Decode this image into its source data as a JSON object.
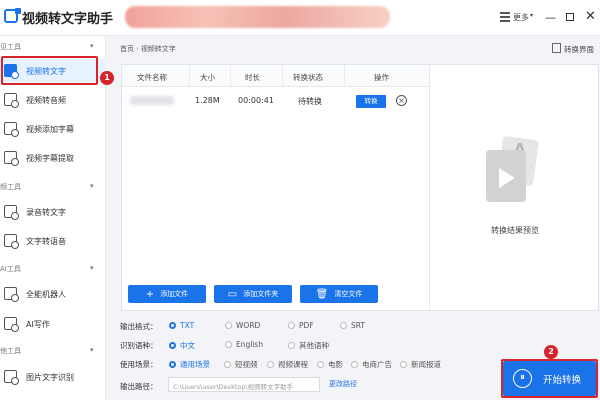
{
  "app": {
    "title": "视频转文字助手"
  },
  "titlebar": {
    "more_label": "更多",
    "more_arrow": "▾",
    "min": "—",
    "max": "",
    "close": "✕"
  },
  "sidebar": {
    "groups": [
      {
        "label": "见工具",
        "caret": "▾"
      },
      {
        "label": "频工具",
        "caret": "▾"
      },
      {
        "label": "AI工具",
        "caret": "▾"
      },
      {
        "label": "他工具",
        "caret": "▾"
      }
    ],
    "items": [
      {
        "label": "视频转文字",
        "active": true
      },
      {
        "label": "视频转音频"
      },
      {
        "label": "视频添加字幕"
      },
      {
        "label": "视频字幕提取"
      },
      {
        "label": "录音转文字"
      },
      {
        "label": "文字转语音"
      },
      {
        "label": "全能机器人"
      },
      {
        "label": "AI写作"
      },
      {
        "label": "图片文字识别"
      }
    ]
  },
  "breadcrumb": {
    "home": "首页",
    "sep": "›",
    "current": "视频转文字"
  },
  "switch_interface": "转换界面",
  "table": {
    "headers": [
      "文件名称",
      "大小",
      "时长",
      "转换状态",
      "操作"
    ],
    "rows": [
      {
        "size": "1.28M",
        "duration": "00:00:41",
        "status": "待转换",
        "action": "转换",
        "delete": "×"
      }
    ]
  },
  "preview": {
    "label": "转换结果预览",
    "letter": "A"
  },
  "buttons": {
    "add_file": "添加文件",
    "add_folder": "添加文件夹",
    "clear_files": "清空文件",
    "start": "开始转换"
  },
  "options": {
    "format": {
      "label": "输出格式：",
      "choices": [
        "TXT",
        "WORD",
        "PDF",
        "SRT"
      ],
      "selected": "TXT"
    },
    "language": {
      "label": "识别语种：",
      "choices": [
        "中文",
        "English",
        "其他语种"
      ],
      "selected": "中文"
    },
    "scene": {
      "label": "使用场景：",
      "choices": [
        "通用场景",
        "短视频",
        "视频课程",
        "电影",
        "电商广告",
        "新闻报道"
      ],
      "selected": "通用场景"
    },
    "path": {
      "label": "输出路径：",
      "value": "C:\\Users\\user\\Desktop\\视频转文字助手",
      "change": "更改路径"
    }
  },
  "badges": {
    "step1": "1",
    "step2": "2"
  },
  "colors": {
    "accent": "#1a73e8",
    "highlight": "#d7232c"
  }
}
